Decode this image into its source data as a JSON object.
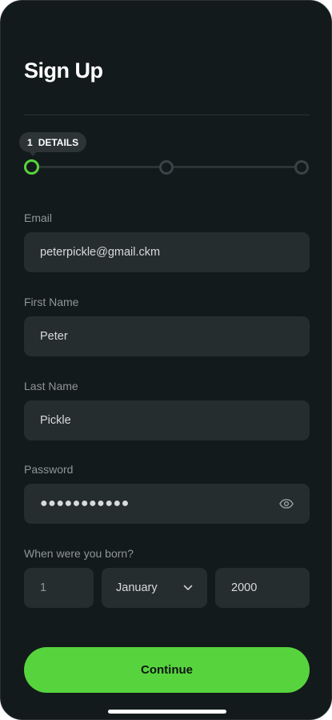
{
  "page": {
    "title": "Sign Up"
  },
  "stepper": {
    "current_step_number": "1",
    "current_step_label": "DETAILS",
    "total_steps": 3,
    "active_color": "#57d43d",
    "inactive_color": "#3a4345"
  },
  "form": {
    "email": {
      "label": "Email",
      "value": "peterpickle@gmail.ckm"
    },
    "first_name": {
      "label": "First Name",
      "value": "Peter"
    },
    "last_name": {
      "label": "Last Name",
      "value": "Pickle"
    },
    "password": {
      "label": "Password",
      "masked_value": "●●●●●●●●●●●",
      "toggle_icon": "eye-icon"
    },
    "birth": {
      "label": "When were you born?",
      "day": "1",
      "month": "January",
      "month_icon": "chevron-down-icon",
      "year": "2000"
    }
  },
  "actions": {
    "continue_label": "Continue",
    "accent": "#57d43d"
  }
}
